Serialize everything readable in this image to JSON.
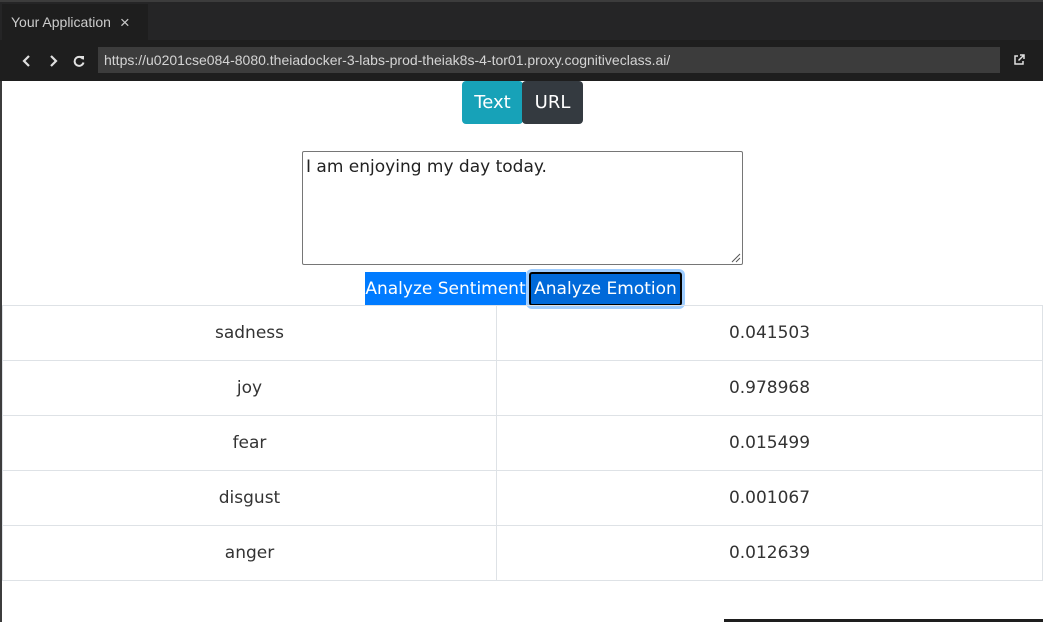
{
  "tab": {
    "title": "Your Application",
    "close_glyph": "×"
  },
  "toolbar": {
    "url": "https://u0201cse084-8080.theiadocker-3-labs-prod-theiak8s-4-tor01.proxy.cognitiveclass.ai/",
    "icons": [
      "chevron-left-icon",
      "chevron-right-icon",
      "refresh-icon",
      "external-link-icon"
    ]
  },
  "mode_buttons": {
    "text": "Text",
    "url": "URL"
  },
  "input": {
    "value": "I am enjoying my day today."
  },
  "actions": {
    "sentiment": "Analyze Sentiment",
    "emotion": "Analyze Emotion"
  },
  "results": [
    {
      "emotion": "sadness",
      "score": "0.041503"
    },
    {
      "emotion": "joy",
      "score": "0.978968"
    },
    {
      "emotion": "fear",
      "score": "0.015499"
    },
    {
      "emotion": "disgust",
      "score": "0.001067"
    },
    {
      "emotion": "anger",
      "score": "0.012639"
    }
  ],
  "colors": {
    "text_button": "#17a2b8",
    "url_button": "#343a40",
    "analyze_button": "#007bff",
    "chrome_bg": "#1e1e1e"
  }
}
